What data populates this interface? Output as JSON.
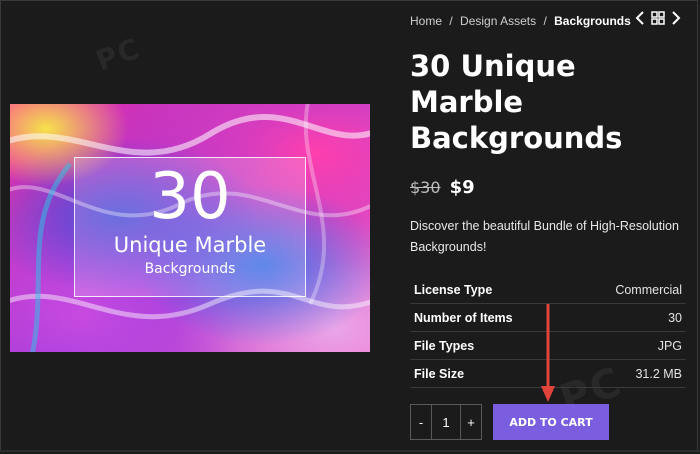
{
  "breadcrumb": {
    "items": [
      "Home",
      "Design Assets"
    ],
    "current": "Backgrounds",
    "separator": "/"
  },
  "nav": {
    "prev_icon": "chevron-left-icon",
    "grid_icon": "grid-icon",
    "next_icon": "chevron-right-icon"
  },
  "product": {
    "title": "30 Unique Marble Backgrounds",
    "old_price": "$30",
    "new_price": "$9",
    "description": "Discover the beautiful Bundle of High-Resolution Backgrounds!",
    "image": {
      "number": "30",
      "line1": "Unique Marble",
      "line2": "Backgrounds"
    }
  },
  "specs": [
    {
      "key": "License Type",
      "value": "Commercial"
    },
    {
      "key": "Number of Items",
      "value": "30"
    },
    {
      "key": "File Types",
      "value": "JPG"
    },
    {
      "key": "File Size",
      "value": "31.2 MB"
    }
  ],
  "cart": {
    "minus_label": "-",
    "quantity": "1",
    "plus_label": "+",
    "add_label": "ADD TO CART"
  },
  "colors": {
    "background": "#1c1b1c",
    "accent": "#7b5ee0",
    "annotation_arrow": "#e0443a"
  },
  "watermark": {
    "top": "PC",
    "bottom": "PC"
  }
}
